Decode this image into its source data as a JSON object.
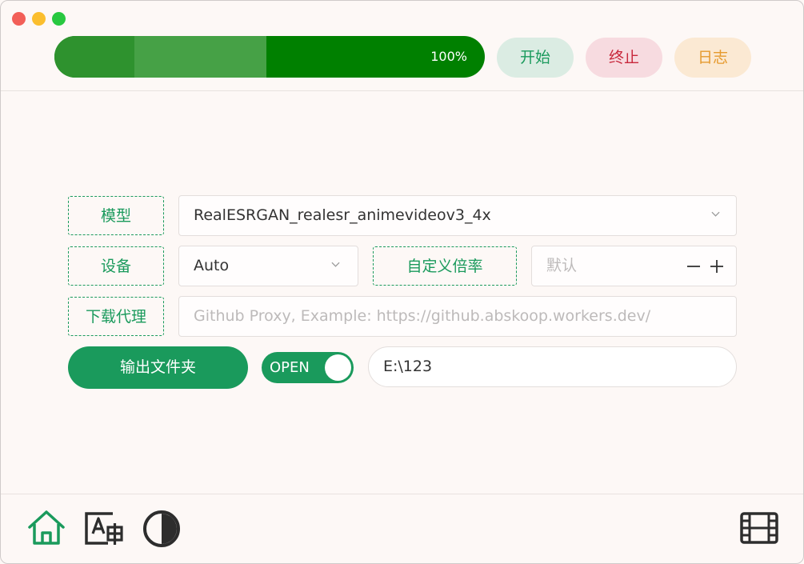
{
  "titlebar": {
    "buttons": [
      "close",
      "minimize",
      "zoom"
    ]
  },
  "progress": {
    "value_percent": 100,
    "label": "100%"
  },
  "actions": {
    "start": "开始",
    "stop": "终止",
    "log": "日志"
  },
  "form": {
    "model": {
      "label": "模型",
      "value": "RealESRGAN_realesr_animevideov3_4x"
    },
    "device": {
      "label": "设备",
      "value": "Auto"
    },
    "custom_scale": {
      "label": "自定义倍率",
      "placeholder": "默认"
    },
    "proxy": {
      "label": "下载代理",
      "placeholder": "Github Proxy, Example: https://github.abskoop.workers.dev/"
    },
    "output": {
      "button": "输出文件夹",
      "toggle_label": "OPEN",
      "toggle_on": true,
      "path": "E:\\123"
    }
  },
  "bottom_nav": {
    "icons": [
      "home-icon",
      "translate-icon",
      "theme-contrast-icon",
      "film-icon"
    ]
  },
  "colors": {
    "accent": "#1a9a5c",
    "progress": "#008000",
    "stop": "#c8283c",
    "log": "#e69a2e",
    "background": "#fdf8f6"
  }
}
